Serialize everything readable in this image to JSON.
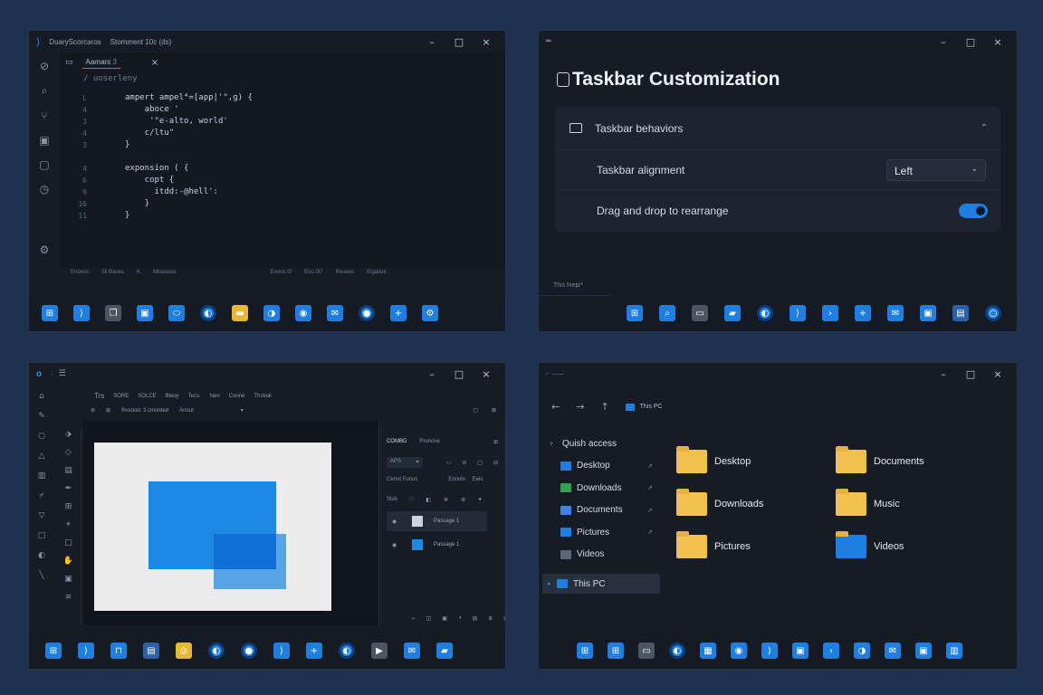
{
  "code_window": {
    "title": "DuaryScorcaros",
    "subtitle": "Stomment 10c (ds)",
    "tab_label": "Aamars",
    "tab_mark": "3",
    "breadcrumb": "/ uoserleny",
    "lines": [
      {
        "n": "L",
        "t": "ampert ampel⁴=[app|'\",g) {"
      },
      {
        "n": "4",
        "t": "    aboce '"
      },
      {
        "n": "3",
        "t": "     '\"e-alto, world'"
      },
      {
        "n": "4",
        "t": "    c/ltu\""
      },
      {
        "n": "3",
        "t": "}"
      },
      {
        "n": "",
        "t": ""
      },
      {
        "n": "4",
        "t": "exponsion ( {"
      },
      {
        "n": "6",
        "t": "    copt {"
      },
      {
        "n": "9",
        "t": "      itdd:-@hell':"
      },
      {
        "n": "16",
        "t": "    }"
      },
      {
        "n": "11",
        "t": "}"
      }
    ],
    "status": [
      "Enonos",
      "5li Baoes",
      "K",
      "Mloasoce",
      "Eooos 0l",
      "Eoo 0l7",
      "Reoees",
      "Elgatiok"
    ],
    "taskbar_icons": [
      "start-icon",
      "vscode-icon",
      "copy-icon",
      "store-icon",
      "toggle-icon",
      "edge-icon",
      "files-icon",
      "edge-blue-icon",
      "camera-icon",
      "mail-icon",
      "record-icon",
      "plus-icon",
      "settings-icon"
    ]
  },
  "settings_window": {
    "page_title": "Taskbar Customization",
    "section_title": "Taskbar behaviors",
    "alignment_label": "Taskbar alignment",
    "alignment_value": "Left",
    "drag_label": "Drag and drop to rearrange",
    "drag_enabled": true,
    "footer_text": "This hiep/*",
    "taskbar_icons": [
      "start-icon",
      "search-icon",
      "monitor-icon",
      "folder-icon",
      "edge-icon",
      "vscode-icon",
      "terminal-icon",
      "plus-icon",
      "mail-icon",
      "store-icon",
      "photos-icon",
      "cortana-icon"
    ]
  },
  "design_window": {
    "logo": "o",
    "menu": [
      "Trs",
      "SORE",
      "SOLCE",
      "Bleoy",
      "Tecs.",
      "Neo",
      "Conne",
      "Thsbok"
    ],
    "toolbar_value": "Rusood: 3 cmonted",
    "toolbar_extra": "Anout",
    "panel_tabs": [
      "COMBD",
      "Pronove"
    ],
    "panel_dropdown": "APS",
    "panel_header": [
      "Cenot Funos",
      "Eonols",
      "Eels"
    ],
    "layers": [
      "Passage 1",
      "Passage 1"
    ],
    "shapes": {
      "blue_big": "#1e88e5",
      "blue_small": "#4aa6ef",
      "overlap": "#0f6fd4",
      "canvas": "#ececec"
    },
    "taskbar_icons": [
      "start-icon",
      "vscode-icon",
      "bookmark-icon",
      "photos-icon",
      "chrome-icon",
      "edge-icon",
      "record-icon",
      "vscode-icon",
      "plus-icon",
      "edge-icon",
      "media-icon",
      "mail-icon",
      "folder-icon"
    ]
  },
  "explorer_window": {
    "address": "This PC",
    "sidebar": [
      {
        "label": "Quish access",
        "icon": "star-icon",
        "pinned": false
      },
      {
        "label": "Desktop",
        "icon": "desktop-icon",
        "pinned": true
      },
      {
        "label": "Downloads",
        "icon": "download-icon",
        "pinned": true
      },
      {
        "label": "Documents",
        "icon": "document-icon",
        "pinned": true
      },
      {
        "label": "Pictures",
        "icon": "pictures-icon",
        "pinned": true
      },
      {
        "label": "Videos",
        "icon": "video-icon",
        "pinned": false
      }
    ],
    "this_pc_label": "This PC",
    "folders": [
      {
        "label": "Desktop",
        "color": "#f2c14e"
      },
      {
        "label": "Documents",
        "color": "#f2c14e"
      },
      {
        "label": "Downloads",
        "color": "#f2c14e"
      },
      {
        "label": "Music",
        "color": "#f2c14e"
      },
      {
        "label": "Pictures",
        "color": "#f2c14e"
      },
      {
        "label": "Videos",
        "color": "#1f7fe0"
      }
    ],
    "taskbar_icons": [
      "start-icon",
      "start-icon",
      "monitor-icon",
      "edge-icon",
      "calendar-icon",
      "camera-icon",
      "vscode-icon",
      "store-icon",
      "terminal-icon",
      "edge-blue-icon",
      "mail-icon",
      "store-icon",
      "devices-icon"
    ]
  },
  "colors": {
    "accent": "#1f7fe0",
    "desktop": "#1c3250",
    "window": "#161c26"
  }
}
